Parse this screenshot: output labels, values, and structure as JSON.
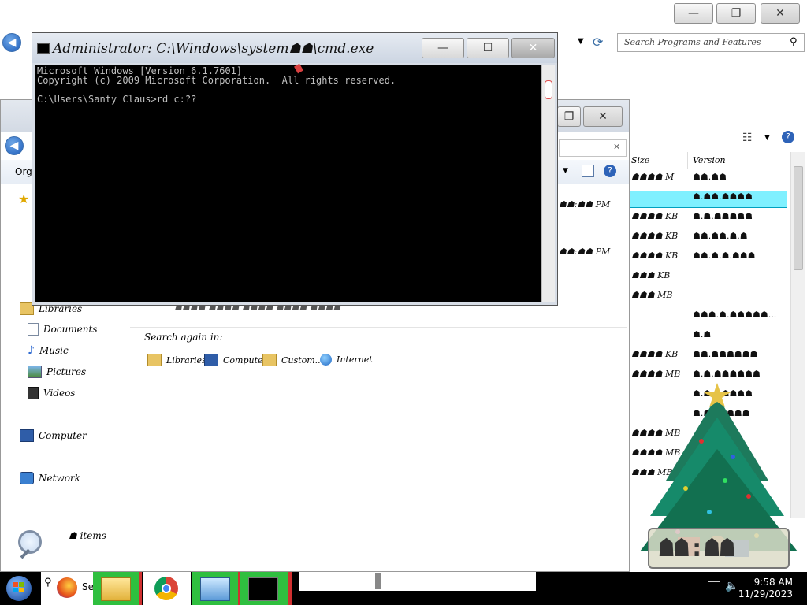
{
  "control_panel": {
    "search_placeholder": "Search Programs and Features",
    "column_size": "Size",
    "column_version": "Version",
    "size_values": [
      "☗☗☗☗ M",
      "☗☗☗☗ KB",
      "☗☗☗☗ KB",
      "☗☗☗☗ KB",
      "☗☗☗ KB",
      "☗☗☗ MB",
      "☗☗☗☗ KB",
      "☗☗☗☗ MB",
      "☗☗☗☗ MB",
      "☗☗☗☗ MB",
      "☗☗☗ MB"
    ],
    "version_values": [
      "☗☗.☗☗",
      "☗.☗☗.☗☗☗☗",
      "☗.☗.☗☗☗☗☗",
      "☗☗.☗☗.☗.☗",
      "☗☗.☗.☗.☗☗☗",
      "",
      "☗☗☗.☗.☗☗☗☗☗...",
      "☗.☗",
      "☗☗.☗☗☗☗☗☗",
      "☗.☗.☗☗☗☗☗☗",
      "☗.☗.☗☗☗☗☗",
      "☗.☗☗☗☗☗☗"
    ]
  },
  "explorer": {
    "organize_label": "Orga",
    "date_fragment": "☗☗:☗☗ PM",
    "nav": {
      "libraries": "Libraries",
      "documents": "Documents",
      "music": "Music",
      "pictures": "Pictures",
      "videos": "Videos",
      "computer": "Computer",
      "network": "Network"
    },
    "search_again_label": "Search again in:",
    "search_again_items": [
      "Libraries",
      "Computer",
      "Custom...",
      "Internet"
    ],
    "items_count": "☗ items",
    "hidden_row": "☗☗☗☗ ☗☗☗☗ ☗☗☗☗ ☗☗☗☗ ☗☗☗☗"
  },
  "cmd": {
    "title": "Administrator: C:\\Windows\\system☗☗\\cmd.exe",
    "line1": "Microsoft Windows [Version 6.1.7601]",
    "line2": "Copyright (c) 2009 Microsoft Corporation.  All rights reserved.",
    "line3": "",
    "line4": "C:\\Users\\Santy Claus>rd c:??"
  },
  "gadget": {
    "clock_text": "☗☗:☗☗"
  },
  "taskbar": {
    "start": "Start",
    "search_fragment": "Se",
    "time": "9:58 AM",
    "date": "11/29/2023",
    "colors": {
      "active_bg": "#2fbf3f",
      "separator": "#d03030"
    }
  },
  "icons": [
    "minimize-icon",
    "maximize-icon",
    "close-icon",
    "back-icon",
    "forward-icon",
    "refresh-icon",
    "search-icon",
    "help-icon",
    "view-icon",
    "star-icon"
  ]
}
